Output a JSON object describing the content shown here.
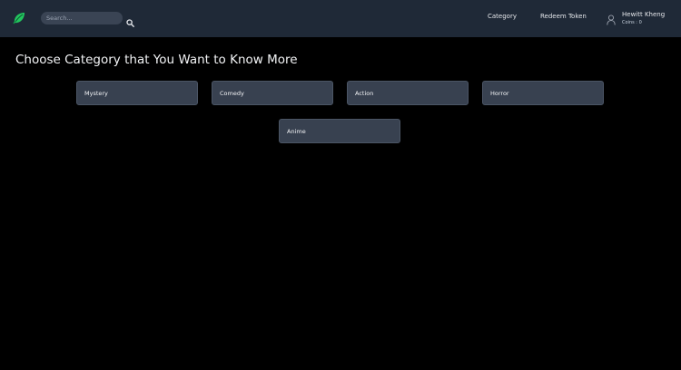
{
  "navbar": {
    "logo_icon": "leaf-logo-icon",
    "search": {
      "placeholder": "Search...",
      "value": "",
      "icon": "search-icon"
    },
    "links": [
      {
        "label": "Category"
      },
      {
        "label": "Redeem Token"
      }
    ],
    "user": {
      "icon": "user-icon",
      "name": "Hewitt Kheng",
      "coins_text": "Coins : 0"
    }
  },
  "main": {
    "heading": "Choose Category that You Want to Know More",
    "categories": [
      {
        "label": "Mystery"
      },
      {
        "label": "Comedy"
      },
      {
        "label": "Action"
      },
      {
        "label": "Horror"
      },
      {
        "label": "Anime"
      }
    ]
  },
  "colors": {
    "navbar_bg": "#1f2937",
    "page_bg": "#000000",
    "card_bg": "#384150",
    "logo_green": "#22c55e"
  }
}
